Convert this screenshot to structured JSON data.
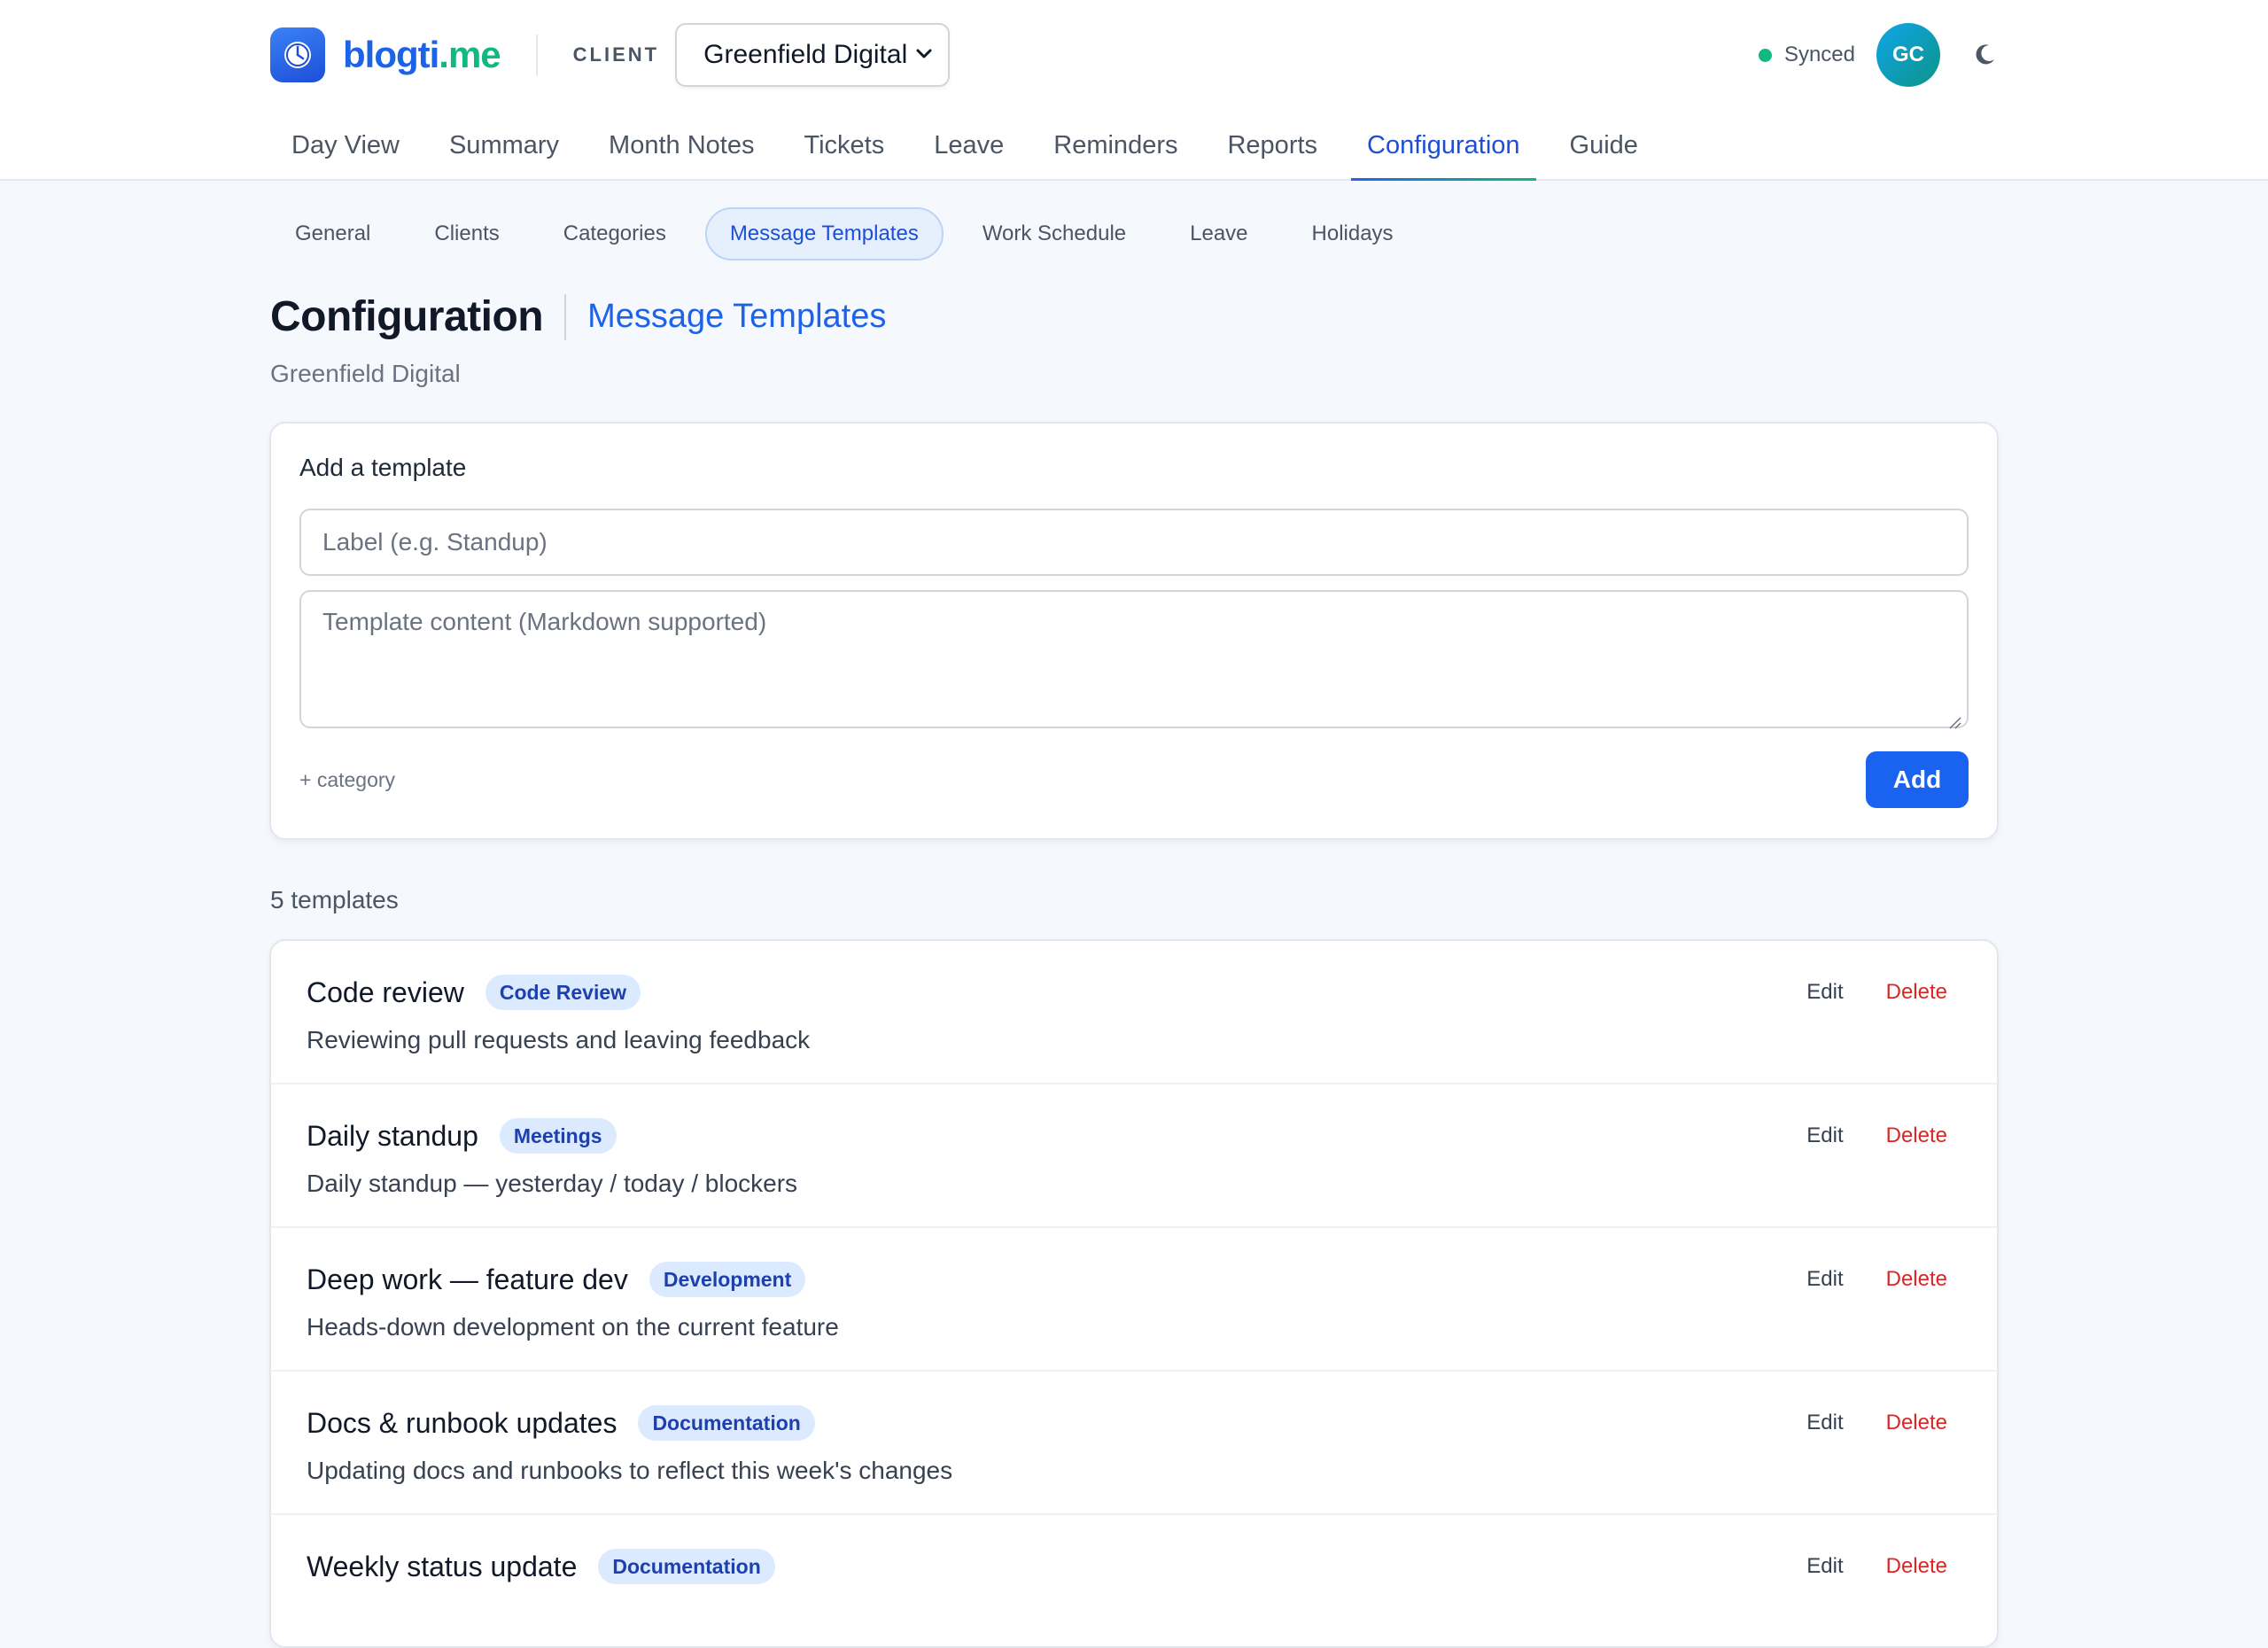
{
  "app": {
    "logo_part1": "blogti",
    "logo_part2": ".me"
  },
  "client": {
    "label": "CLIENT",
    "selected": "Greenfield Digital"
  },
  "status": {
    "sync_text": "Synced",
    "avatar_initials": "GC"
  },
  "main_nav": [
    {
      "label": "Day View"
    },
    {
      "label": "Summary"
    },
    {
      "label": "Month Notes"
    },
    {
      "label": "Tickets"
    },
    {
      "label": "Leave"
    },
    {
      "label": "Reminders"
    },
    {
      "label": "Reports"
    },
    {
      "label": "Configuration",
      "active": true
    },
    {
      "label": "Guide"
    }
  ],
  "sub_nav": [
    {
      "label": "General"
    },
    {
      "label": "Clients"
    },
    {
      "label": "Categories"
    },
    {
      "label": "Message Templates",
      "active": true
    },
    {
      "label": "Work Schedule"
    },
    {
      "label": "Leave"
    },
    {
      "label": "Holidays"
    }
  ],
  "page": {
    "title": "Configuration",
    "subtitle": "Message Templates",
    "client_name": "Greenfield Digital"
  },
  "add_form": {
    "title": "Add a template",
    "label_placeholder": "Label (e.g. Standup)",
    "content_placeholder": "Template content (Markdown supported)",
    "category_link": "+ category",
    "add_button": "Add"
  },
  "templates": {
    "count_text": "5 templates",
    "edit_label": "Edit",
    "delete_label": "Delete",
    "items": [
      {
        "name": "Code review",
        "category": "Code Review",
        "description": "Reviewing pull requests and leaving feedback"
      },
      {
        "name": "Daily standup",
        "category": "Meetings",
        "description": "Daily standup — yesterday / today / blockers"
      },
      {
        "name": "Deep work — feature dev",
        "category": "Development",
        "description": "Heads-down development on the current feature"
      },
      {
        "name": "Docs & runbook updates",
        "category": "Documentation",
        "description": "Updating docs and runbooks to reflect this week's changes"
      },
      {
        "name": "Weekly status update",
        "category": "Documentation",
        "description": ""
      }
    ]
  },
  "colors": {
    "accent": "#1d63e8",
    "brand_green": "#10b981",
    "delete": "#dc2626",
    "badge_bg": "#dbeafe"
  }
}
